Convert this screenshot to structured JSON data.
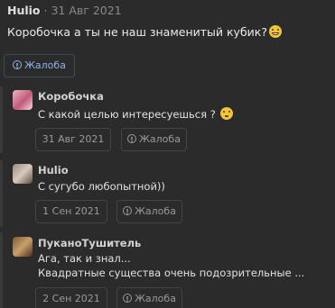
{
  "post": {
    "author": "Hulio",
    "separator": "·",
    "date": "31 Авг 2021",
    "text": "Коробочка а ты не наш знаменитый кубик?",
    "report_label": "Жалоба"
  },
  "replies": [
    {
      "author": "Коробочка",
      "lines": [
        "С какой целью интересуешься ?"
      ],
      "date": "31 Авг 2021",
      "report_label": "Жалоба"
    },
    {
      "author": "Hulio",
      "lines": [
        "С сугубо любопытной))"
      ],
      "date": "1 Сен 2021",
      "report_label": "Жалоба"
    },
    {
      "author": "ПуканоТушитель",
      "lines": [
        "Ага, так и знал...",
        "Квадратные существа очень подозрительные ..."
      ],
      "date": "2 Сен 2021",
      "report_label": "Жалоба"
    }
  ],
  "icons": {
    "report": "alert-circle-icon",
    "emoji_grin": "grinning-emoji-icon",
    "emoji_think": "thinking-emoji-icon"
  },
  "colors": {
    "background": "#2b2b2b",
    "accent": "#8db4e8",
    "muted": "#8a8a8a"
  }
}
